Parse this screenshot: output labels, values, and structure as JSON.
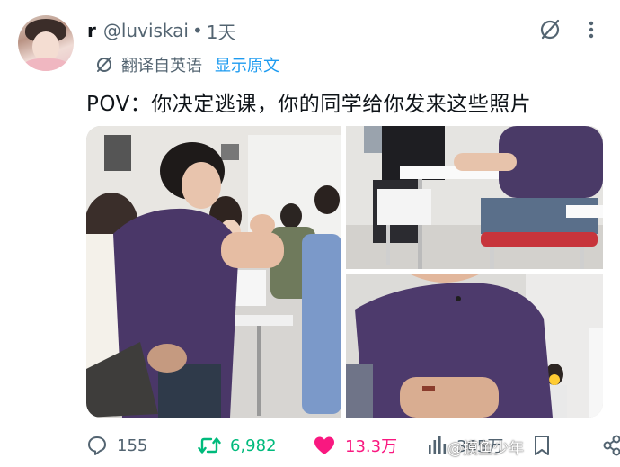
{
  "author": {
    "display_name": "r",
    "handle": "@luviskai",
    "separator": "•",
    "time": "1天"
  },
  "translation": {
    "label": "翻译自英语",
    "show_original": "显示原文"
  },
  "tweet": {
    "text": "POV：你决定逃课，你的同学给你发来这些照片"
  },
  "media": {
    "images": [
      {
        "description_name": "classroom-photo-1"
      },
      {
        "description_name": "classroom-photo-2"
      },
      {
        "description_name": "classroom-photo-3"
      }
    ]
  },
  "actions": {
    "replies": "155",
    "retweets": "6,982",
    "likes": "13.3万",
    "views": "365万"
  },
  "watermark": "@摸鱼少年",
  "colors": {
    "accent_blue": "#1d9bf0",
    "retweet_green": "#00ba7c",
    "like_pink": "#f91880",
    "muted_gray": "#536471",
    "text_black": "#0f1419"
  },
  "icons": {
    "grok": "grok-icon",
    "more": "more-icon",
    "translate": "translate-icon",
    "reply": "reply-icon",
    "retweet": "retweet-icon",
    "like": "heart-icon",
    "views": "views-icon",
    "bookmark": "bookmark-icon",
    "share": "share-icon"
  }
}
